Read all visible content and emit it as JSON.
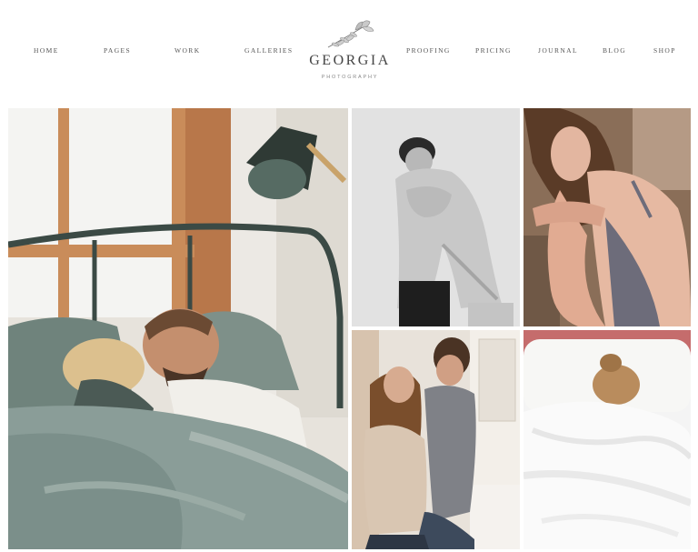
{
  "nav": {
    "left": [
      "HOME",
      "PAGES",
      "WORK",
      "GALLERIES"
    ],
    "right": [
      "PROOFING",
      "PRICING",
      "JOURNAL",
      "BLOG",
      "SHOP"
    ]
  },
  "brand": {
    "title": "GEORGIA",
    "subtitle": "PHOTOGRAPHY",
    "icon": "floral-sprig-icon"
  },
  "gallery": {
    "photos": [
      {
        "name": "couple-in-bed-photo",
        "icon": "photo"
      },
      {
        "name": "woman-sweater-bw-photo",
        "icon": "photo"
      },
      {
        "name": "woman-swimsuit-photo",
        "icon": "photo"
      },
      {
        "name": "couple-embrace-kitchen-photo",
        "icon": "photo"
      },
      {
        "name": "woman-under-blanket-photo",
        "icon": "photo"
      }
    ]
  }
}
